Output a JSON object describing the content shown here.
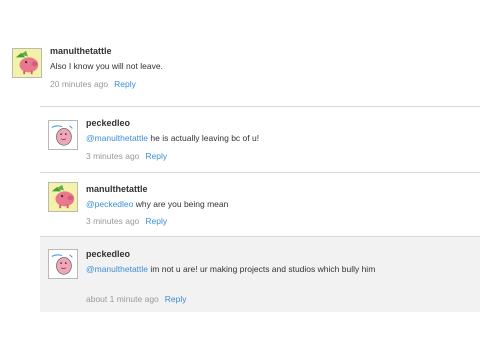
{
  "comments": [
    {
      "author": "manulthetattle",
      "text": "Also I know you will not leave.",
      "time": "20 minutes ago",
      "reply": "Reply",
      "avatar": "pink-pig-green-bg-avatar"
    },
    {
      "author": "peckedleo",
      "mention": "@manulthetattle",
      "text": " he is actually leaving bc of u!",
      "time": "3 minutes ago",
      "reply": "Reply",
      "avatar": "pink-blob-sketch-avatar"
    },
    {
      "author": "manulthetattle",
      "mention": "@peckedleo",
      "text": " why are you being mean",
      "time": "3 minutes ago",
      "reply": "Reply",
      "avatar": "pink-pig-green-bg-avatar"
    },
    {
      "author": "peckedleo",
      "mention": "@manulthetattle",
      "text": " im not u are! ur making projects and studios which bully him",
      "time": "about 1 minute ago",
      "reply": "Reply",
      "avatar": "pink-blob-sketch-avatar"
    }
  ],
  "colors": {
    "link": "#3a8fd9",
    "meta": "#9a9a9a",
    "shaded_bg": "#f2f2f2"
  }
}
